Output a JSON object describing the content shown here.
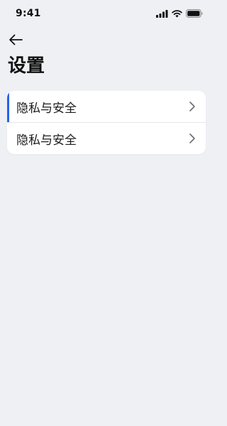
{
  "status_bar": {
    "time": "9:41",
    "icons": [
      "cellular-signal-icon",
      "wifi-icon",
      "battery-icon"
    ]
  },
  "header": {
    "back_icon": "arrow-left-icon",
    "title": "设置"
  },
  "settings": {
    "items": [
      {
        "label": "隐私与安全",
        "icon": "chevron-right-icon",
        "selected": true
      },
      {
        "label": "隐私与安全",
        "icon": "chevron-right-icon",
        "selected": false
      }
    ]
  },
  "colors": {
    "background": "#eef0f4",
    "card": "#ffffff",
    "accent": "#2563eb",
    "chevron": "#8e8e93"
  }
}
